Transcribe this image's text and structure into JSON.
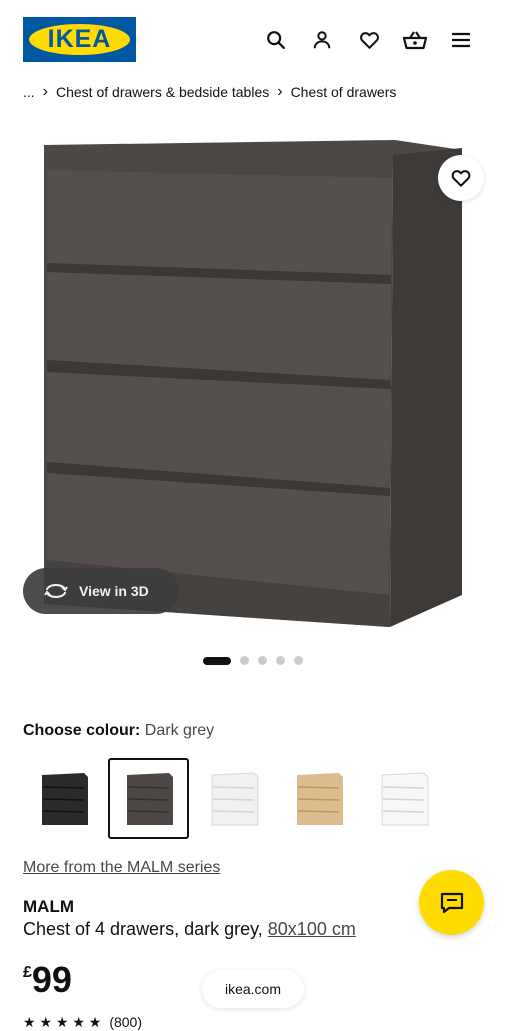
{
  "header": {
    "logo_text": "IKEA",
    "icons": [
      "search-icon",
      "account-icon",
      "heart-icon",
      "basket-icon",
      "menu-icon"
    ],
    "brand_blue": "#0058a3",
    "brand_yellow": "#ffdb00"
  },
  "breadcrumb": {
    "ellipsis": "...",
    "items": [
      "Chest of drawers & bedside tables",
      "Chest of drawers"
    ]
  },
  "gallery": {
    "view3d_label": "View in 3D",
    "image_count": 5,
    "active_index": 0
  },
  "colour": {
    "label": "Choose colour:",
    "value": "Dark grey",
    "swatches": [
      {
        "name": "black-brown",
        "color": "#2a2a2a"
      },
      {
        "name": "dark grey",
        "color": "#4a4644",
        "selected": true
      },
      {
        "name": "white",
        "color": "#f2f2f2"
      },
      {
        "name": "white stained oak veneer",
        "color": "#d9b98a"
      },
      {
        "name": "high-gloss white",
        "color": "#f7f7f7"
      }
    ]
  },
  "product": {
    "series_link": "More from the MALM series",
    "name": "MALM",
    "description": "Chest of 4 drawers, dark grey, ",
    "size": "80x100 cm",
    "currency": "£",
    "price": "99",
    "rating_stars": "★ ★ ★ ★ ★",
    "rating_count": "(800)"
  },
  "footer": {
    "domain": "ikea.com"
  }
}
